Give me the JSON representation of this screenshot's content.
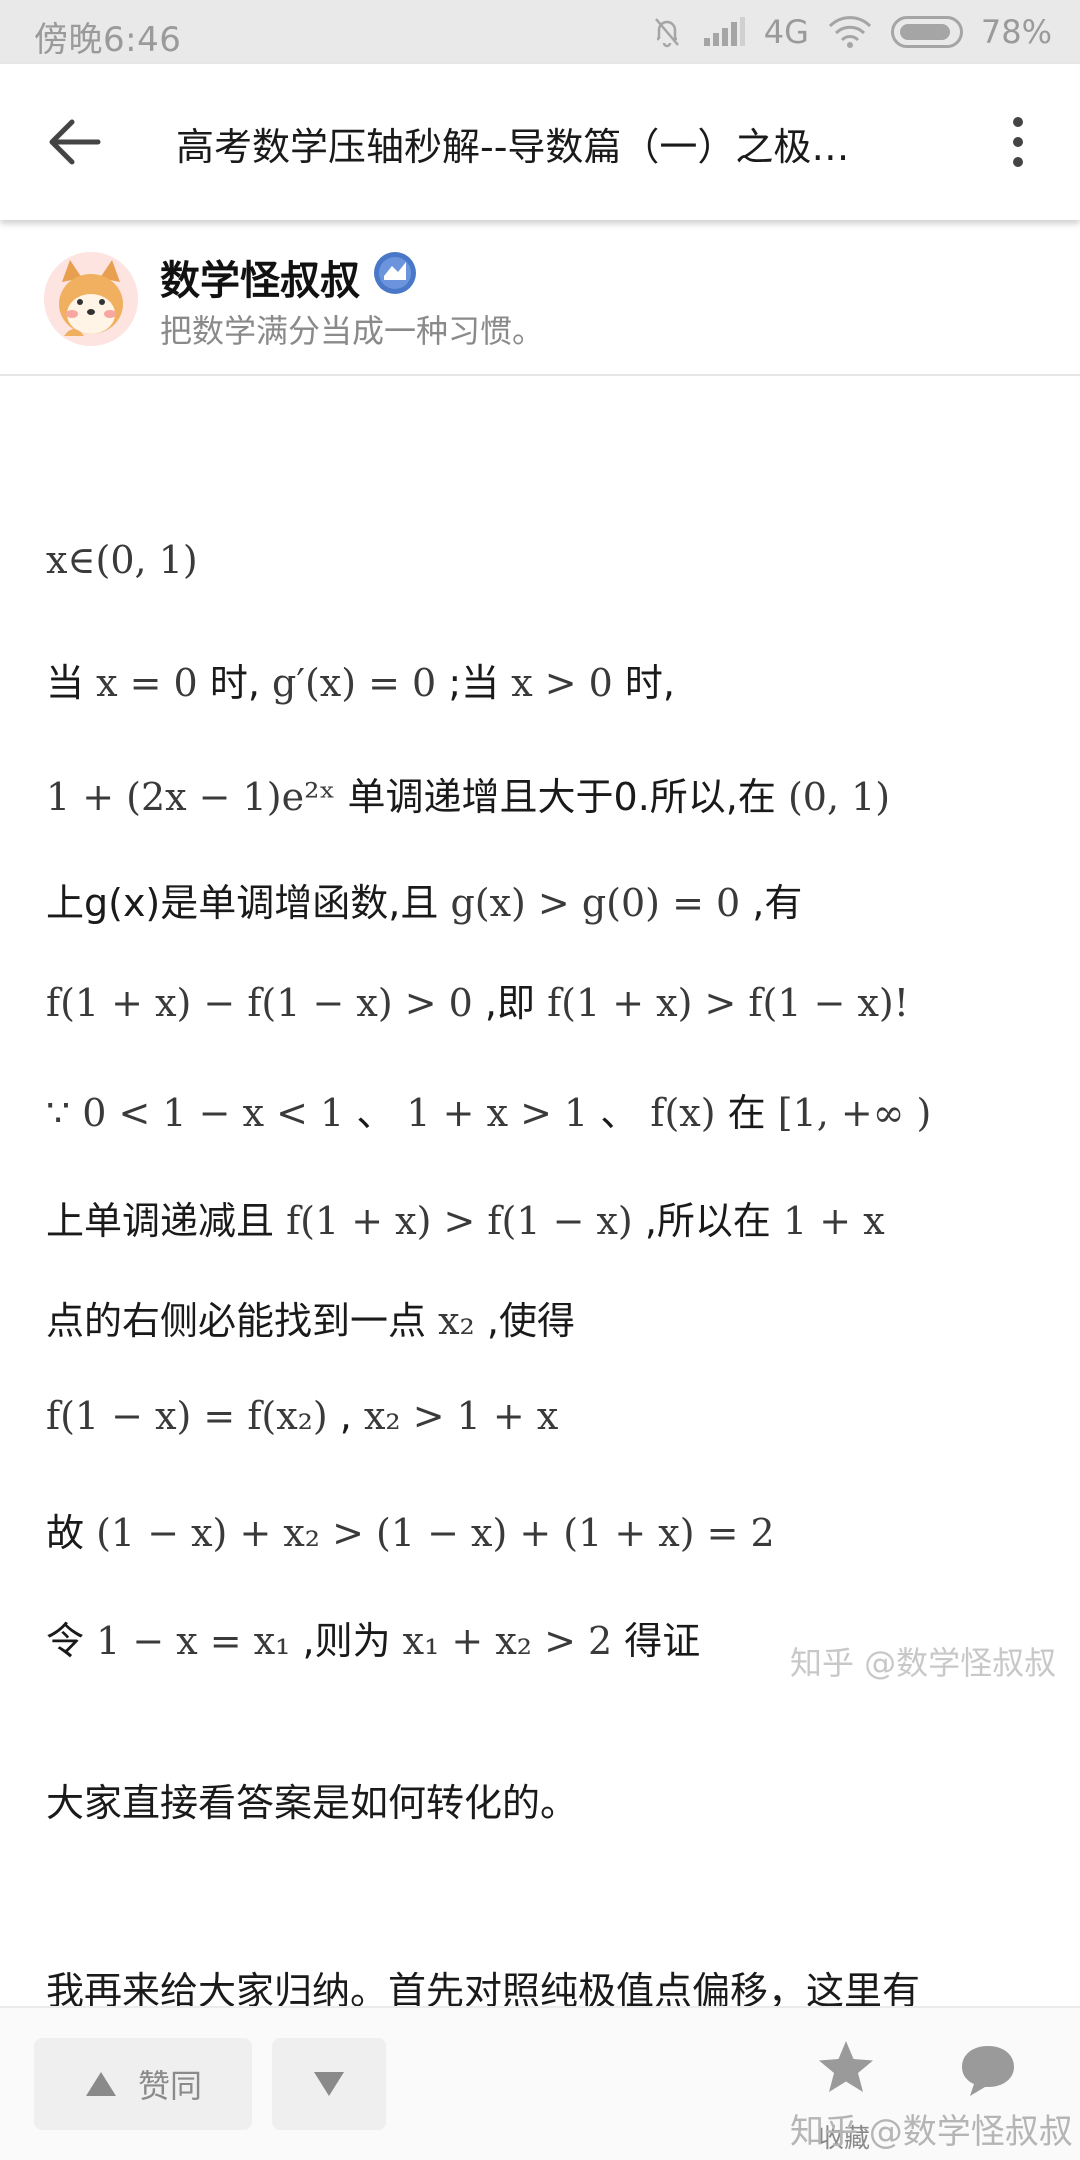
{
  "status_bar": {
    "time": "傍晚6:46",
    "network": "4G",
    "battery": "78%",
    "battery_level": 0.78
  },
  "app_bar": {
    "title": "高考数学压轴秒解--导数篇（一）之极…",
    "back_icon": "arrow-left-icon",
    "more_icon": "more-vertical-icon"
  },
  "author": {
    "name": "数学怪叔叔",
    "bio": "把数学满分当成一种习惯。",
    "badge_icon": "verified-badge-icon"
  },
  "article": {
    "l1_math": "x∈(0, 1)",
    "l2_a": "当",
    "l2_m1": "x = 0",
    "l2_b": "时,",
    "l2_m2": "g′(x) = 0",
    "l2_c": ";当",
    "l2_m3": "x > 0",
    "l2_d": "时,",
    "l3_m1": "1 + (2x − 1)e²ˣ",
    "l3_a": "单调递增且大于0.所以,在",
    "l3_m2": "(0, 1)",
    "l4_a": "上g(x)是单调增函数,且",
    "l4_m": "g(x) > g(0) = 0",
    "l4_b": ",有",
    "l5_m1": "f(1 + x) − f(1 − x) > 0",
    "l5_a": ",即",
    "l5_m2": "f(1 + x) > f(1 − x)!",
    "l6_m1": "∵ 0 < 1 − x < 1",
    "l6_a": "、",
    "l6_m2": "1 + x > 1",
    "l6_b": "、",
    "l6_m3": "f(x)",
    "l6_c": "在",
    "l6_m4": "[1, +∞ )",
    "l7_a": "上单调递减且",
    "l7_m1": "f(1 + x) > f(1 − x)",
    "l7_b": ",所以在",
    "l7_m2": "1 + x",
    "l8_a": "点的右侧必能找到一点",
    "l8_m": "x₂",
    "l8_b": ",使得",
    "l9_m1": "f(1 − x) = f(x₂)",
    "l9_a": ",",
    "l9_m2": "x₂ > 1 + x",
    "l10_a": "故",
    "l10_m": "(1 − x) + x₂ > (1 − x) + (1 + x) = 2",
    "l11_a": "令",
    "l11_m1": "1 − x = x₁",
    "l11_b": ",则为",
    "l11_m2": "x₁ + x₂ > 2",
    "l11_c": "得证",
    "watermark": "知乎 @数学怪叔叔",
    "p1": "大家直接看答案是如何转化的。",
    "p2": "我再来给大家归纳。首先对照纯极值点偏移，这里有"
  },
  "bottom_bar": {
    "vote_up_label": "赞同",
    "favorite_label": "收藏",
    "watermark": "知乎 @数学怪叔叔",
    "favorite_icon": "star-icon",
    "comment_icon": "comment-bubble-icon"
  }
}
